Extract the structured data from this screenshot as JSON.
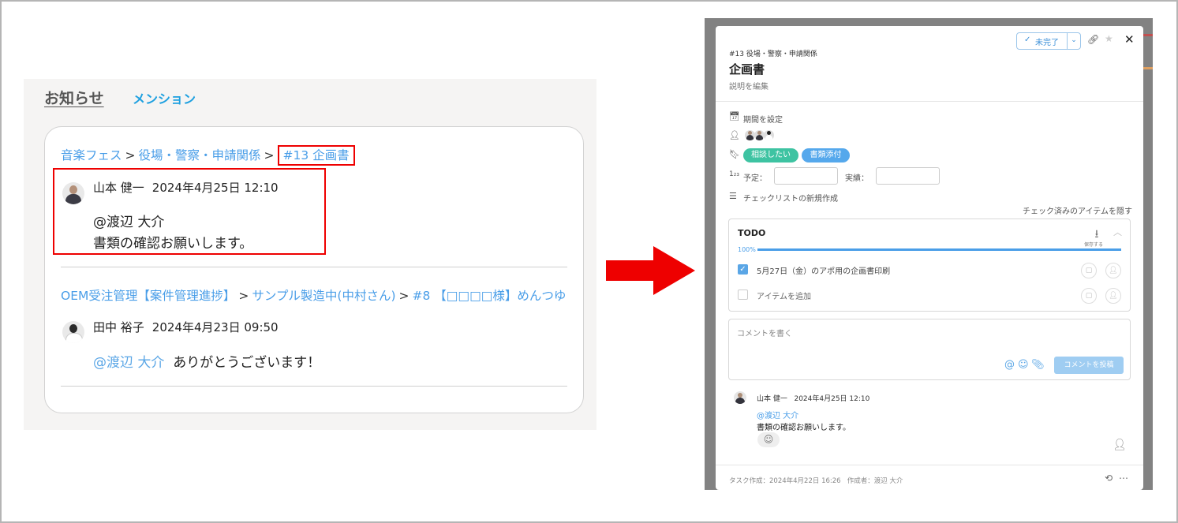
{
  "left_panel": {
    "tabs": {
      "notice": "お知らせ",
      "mention": "メンション"
    },
    "notifications": [
      {
        "breadcrumb": [
          "音楽フェス",
          "役場・警察・申請関係",
          "#13 企画書"
        ],
        "separator": ">",
        "author": "山本 健一",
        "timestamp": "2024年4月25日 12:10",
        "mention": "@渡辺 大介",
        "message": "書類の確認お願いします。"
      },
      {
        "breadcrumb": [
          "OEM受注管理【案件管理進捗】",
          "サンプル製造中(中村さん)",
          "#8 【□□□□様】めんつゆ"
        ],
        "separator": ">",
        "author": "田中 裕子",
        "timestamp": "2024年4月23日 09:50",
        "mention": "@渡辺 大介",
        "message": "ありがとうございます！"
      }
    ]
  },
  "task_modal": {
    "status": {
      "label": "未完了",
      "check_icon": "check-icon",
      "dropdown_icon": "chevron-down-icon"
    },
    "parent": "#13 役場・警察・申請関係",
    "title": "企画書",
    "description_link": "説明を編集",
    "period_label": "期間を設定",
    "tags": [
      {
        "label": "相談したい",
        "color": "#3ec3a2"
      },
      {
        "label": "書類添付",
        "color": "#55a8ec"
      }
    ],
    "planned_label": "予定：",
    "actual_label": "実績：",
    "new_checklist": "チェックリストの新規作成",
    "hide_checked": "チェック済みのアイテムを隠す",
    "checklist": {
      "title": "TODO",
      "save_label": "保存する",
      "progress_text": "100%",
      "progress": 1.0,
      "items": [
        {
          "label": "5月27日（金）のアポ用の企画書印刷",
          "checked": true
        }
      ],
      "add_item_placeholder": "アイテムを追加"
    },
    "comment": {
      "placeholder": "コメントを書く",
      "submit_label": "コメントを投稿"
    },
    "comments": [
      {
        "author": "山本 健一",
        "timestamp": "2024年4月25日 12:10",
        "mention": "@渡辺 大介",
        "body": "書類の確認お願いします。"
      }
    ],
    "footer": {
      "created_label": "タスク作成：",
      "created_at": "2024年4月22日 16:26",
      "creator_label": "作成者：",
      "creator": "渡辺 大介"
    }
  },
  "colors": {
    "link": "#4a9ee8",
    "highlight": "#ee0000",
    "arrow": "#ee0000"
  }
}
